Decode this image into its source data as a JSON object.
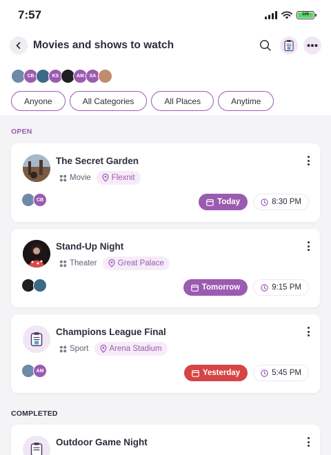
{
  "status": {
    "time": "7:57",
    "battery": "100"
  },
  "header": {
    "title": "Movies and shows to watch",
    "icons": [
      "back-arrow-icon",
      "search-icon",
      "clipboard-icon",
      "more-horizontal-icon"
    ]
  },
  "people": [
    "",
    "CB",
    "",
    "KS",
    "",
    "AM",
    "SA",
    ""
  ],
  "filters": [
    "Anyone",
    "All Categories",
    "All Places",
    "Anytime"
  ],
  "sections": {
    "open": "OPEN",
    "completed": "COMPLETED"
  },
  "cards": [
    {
      "title": "The Secret Garden",
      "type": "Movie",
      "place": "Flexnit",
      "people": [
        "",
        "CB"
      ],
      "date": "Today",
      "date_color": "#9b5bb0",
      "time": "8:30 PM"
    },
    {
      "title": "Stand-Up Night",
      "type": "Theater",
      "place": "Great Palace",
      "people": [
        "",
        ""
      ],
      "date": "Tomorrow",
      "date_color": "#9b5bb0",
      "time": "9:15 PM"
    },
    {
      "title": "Champions League Final",
      "type": "Sport",
      "place": "Arena Stadium",
      "people": [
        "",
        "AM"
      ],
      "date": "Yesterday",
      "date_color": "#d64545",
      "time": "5:45 PM"
    },
    {
      "title": "Outdoor Game Night"
    }
  ],
  "colors": {
    "accent": "#9b5bb0",
    "overdue": "#d64545",
    "text": "#2b2d3a"
  }
}
